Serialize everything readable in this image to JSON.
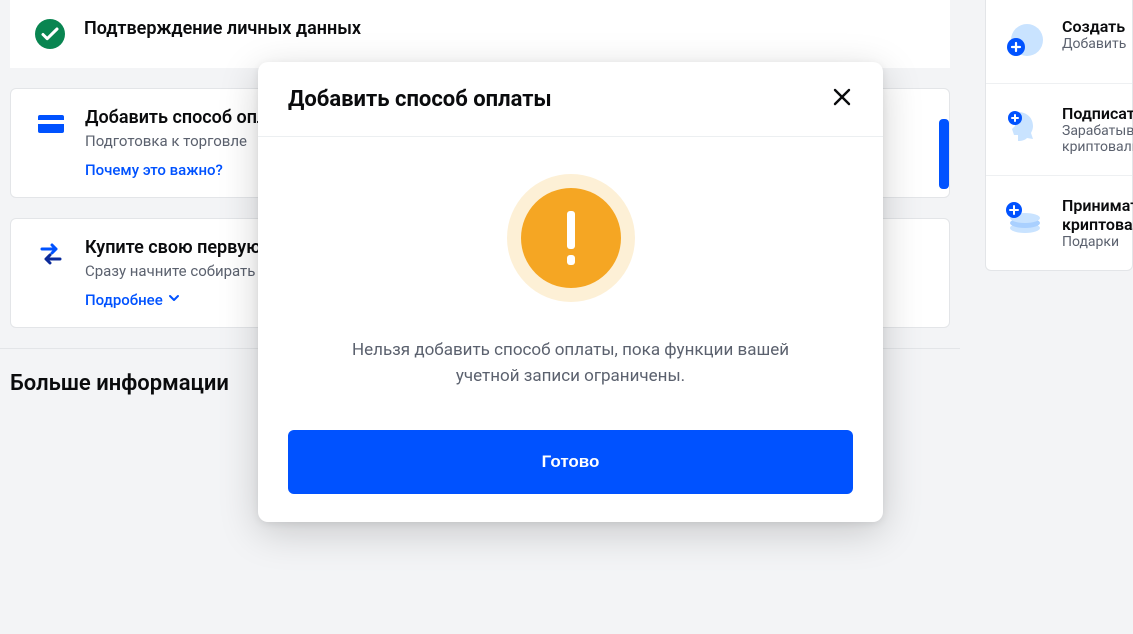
{
  "steps": {
    "verify": {
      "title": "Подтверждение личных данных"
    },
    "payment": {
      "title": "Добавить способ оплаты",
      "sub": "Подготовка к торговле",
      "link": "Почему это важно?"
    },
    "buy": {
      "title": "Купите свою первую криптовалюту",
      "sub": "Сразу начните собирать портфель",
      "link": "Подробнее"
    }
  },
  "section_more": "Больше информации",
  "sidebar": {
    "items": [
      {
        "title": "Создать",
        "sub": "Добавить"
      },
      {
        "title": "Подписаться",
        "sub": "Зарабатывайте\nкриптовалюту"
      },
      {
        "title": "Принимать\nкриптовалюту",
        "sub": "Подарки"
      }
    ]
  },
  "modal": {
    "title": "Добавить способ оплаты",
    "message": "Нельзя добавить способ оплаты, пока функции вашей учетной записи ограничены.",
    "button": "Готово"
  }
}
